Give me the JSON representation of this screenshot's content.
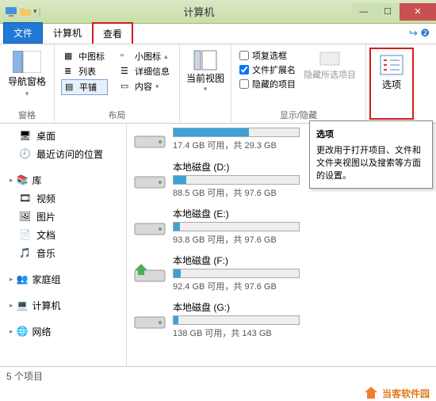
{
  "titlebar": {
    "title": "计算机"
  },
  "tabs": {
    "file": "文件",
    "computer": "计算机",
    "view": "查看"
  },
  "ribbon": {
    "nav": {
      "label": "导航窗格",
      "group": "窗格"
    },
    "layout": {
      "group": "布局",
      "medium": "中图标",
      "small": "小图标",
      "list": "列表",
      "details": "详细信息",
      "tiles": "平铺",
      "content": "内容"
    },
    "curview": {
      "label": "当前视图"
    },
    "showhide": {
      "group": "显示/隐藏",
      "chk1": "项复选框",
      "chk2": "文件扩展名",
      "chk3": "隐藏的项目",
      "hidesel": "隐藏所选项目"
    },
    "options": "选项"
  },
  "tooltip": {
    "title": "选项",
    "body": "更改用于打开项目、文件和文件夹视图以及搜索等方面的设置。"
  },
  "sidebar": {
    "desktop": "桌面",
    "recent": "最近访问的位置",
    "lib": "库",
    "video": "视频",
    "pic": "图片",
    "doc": "文档",
    "music": "音乐",
    "homegroup": "家庭组",
    "computer": "计算机",
    "network": "网络"
  },
  "drives": [
    {
      "name": "",
      "free": "17.4 GB 可用，共 29.3 GB",
      "fill": 60
    },
    {
      "name": "本地磁盘 (D:)",
      "free": "88.5 GB 可用，共 97.6 GB",
      "fill": 10
    },
    {
      "name": "本地磁盘 (E:)",
      "free": "93.8 GB 可用，共 97.6 GB",
      "fill": 5
    },
    {
      "name": "本地磁盘 (F:)",
      "free": "92.4 GB 可用，共 97.6 GB",
      "fill": 6
    },
    {
      "name": "本地磁盘 (G:)",
      "free": "138 GB 可用，共 143 GB",
      "fill": 4
    }
  ],
  "status": "5 个项目",
  "watermark": "当客软件园"
}
